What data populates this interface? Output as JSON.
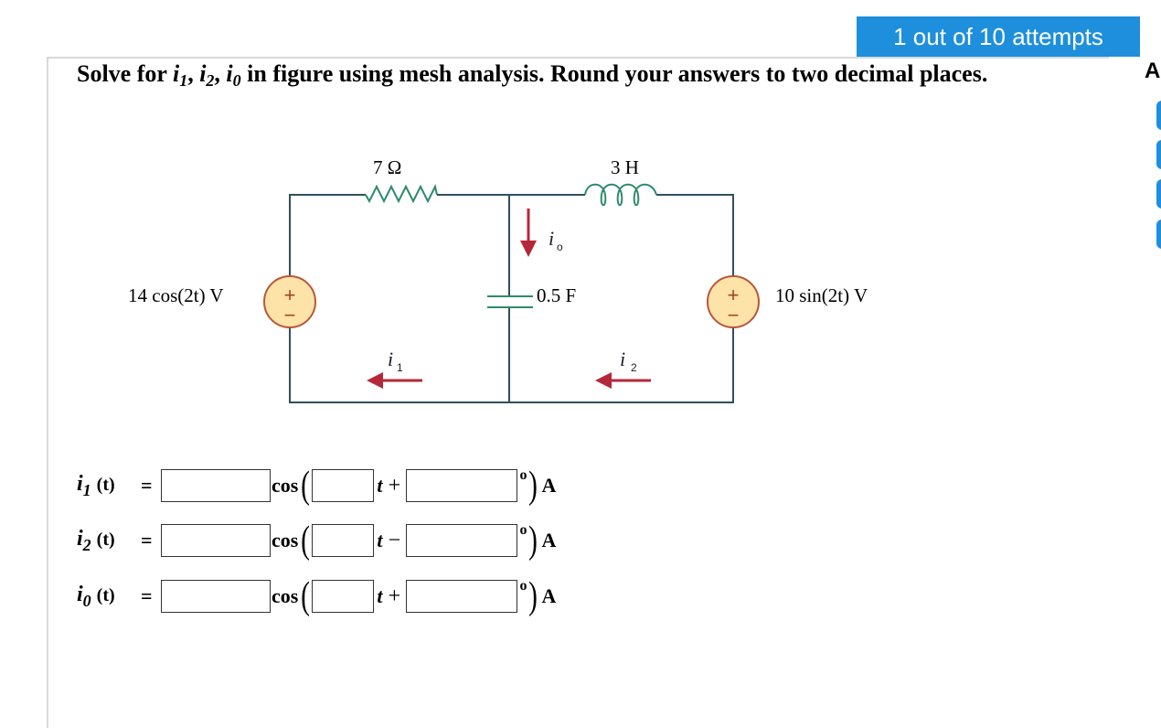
{
  "attempts_badge": "1 out of 10 attempts",
  "question": {
    "prefix": "Solve for ",
    "vars": [
      {
        "base": "i",
        "sub": "1"
      },
      {
        "base": "i",
        "sub": "2"
      },
      {
        "base": "i",
        "sub": "0"
      }
    ],
    "suffix": " in figure using mesh analysis. Round your answers to two decimal places."
  },
  "sidebar": {
    "letter": "A"
  },
  "circuit": {
    "resistor_label": "7 Ω",
    "inductor_label": "3 H",
    "capacitor_label": "0.5 F",
    "left_source_label": "14 cos(2t) V",
    "right_source_label": "10 sin(2t) V",
    "source_plus": "+",
    "source_minus": "−",
    "currents": [
      {
        "name": "i",
        "sub": "o",
        "direction": "down"
      },
      {
        "name": "i",
        "sub": "1",
        "direction": "left"
      },
      {
        "name": "i",
        "sub": "2",
        "direction": "left"
      }
    ],
    "colors": {
      "wire": "#2f4f5f",
      "element": "#2e8b6a",
      "arrow": "#b5283a",
      "source_fill": "#fde3a7",
      "source_stroke": "#b8573a"
    }
  },
  "answers": [
    {
      "var": "i",
      "sub": "1",
      "arg": "(t)",
      "eq": "=",
      "amplitude": "",
      "func": "cos",
      "freq": "",
      "t": "t",
      "op": "+",
      "phase": "",
      "deg": "o",
      "unit": "A"
    },
    {
      "var": "i",
      "sub": "2",
      "arg": "(t)",
      "eq": "=",
      "amplitude": "",
      "func": "cos",
      "freq": "",
      "t": "t",
      "op": "−",
      "phase": "",
      "deg": "o",
      "unit": "A"
    },
    {
      "var": "i",
      "sub": "0",
      "arg": "(t)",
      "eq": "=",
      "amplitude": "",
      "func": "cos",
      "freq": "",
      "t": "t",
      "op": "+",
      "phase": "",
      "deg": "o",
      "unit": "A"
    }
  ]
}
